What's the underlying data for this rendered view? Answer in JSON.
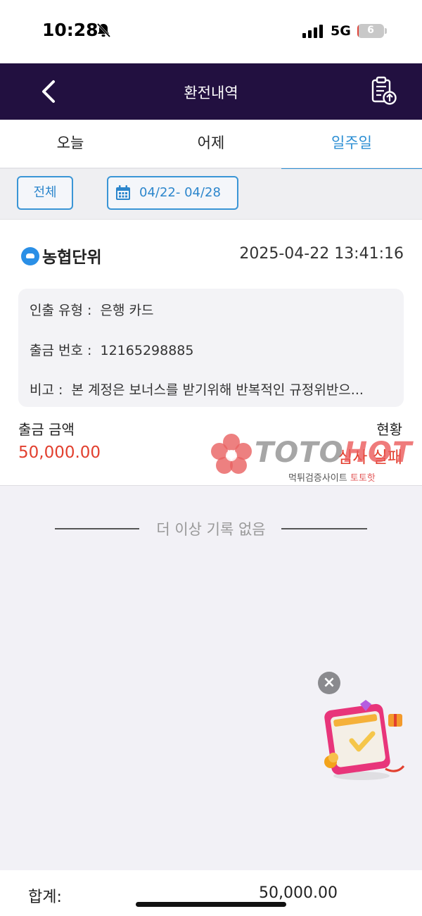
{
  "status_bar": {
    "time": "10:28",
    "network": "5G",
    "battery": "6",
    "battery_level": 0.06
  },
  "header": {
    "title": "환전내역",
    "back_icon": "chevron-left-icon",
    "export_icon": "clipboard-upload-icon"
  },
  "tabs": [
    {
      "label": "오늘",
      "active": false
    },
    {
      "label": "어제",
      "active": false
    },
    {
      "label": "일주일",
      "active": true
    }
  ],
  "filter": {
    "all_label": "전체",
    "date_range": "04/22- 04/28"
  },
  "record": {
    "bank_name": "농협단위",
    "datetime": "2025-04-22 13:41:16",
    "withdraw_type_label": "인출 유형 :",
    "withdraw_type_value": "은행 카드",
    "account_label": "출금 번호 :",
    "account_value": "12165298885",
    "note_label": "비고 :",
    "note_value": "본 계정은 보너스를 받기위해 반복적인 규정위반으...",
    "amount_label": "출금 금액",
    "amount_value": "50,000.00",
    "status_label": "현황",
    "status_value": "심사 실패"
  },
  "watermark": {
    "brand_left": "TOTO",
    "brand_right": "HOT",
    "sub_left": "먹튀검증사이트",
    "sub_right": "토토핫"
  },
  "end_message": "더 이상 기록 없음",
  "footer": {
    "total_label": "합계:",
    "total_value": "50,000.00"
  },
  "colors": {
    "header_bg": "#221040",
    "accent": "#2c8fd4",
    "negative": "#e2402f"
  }
}
